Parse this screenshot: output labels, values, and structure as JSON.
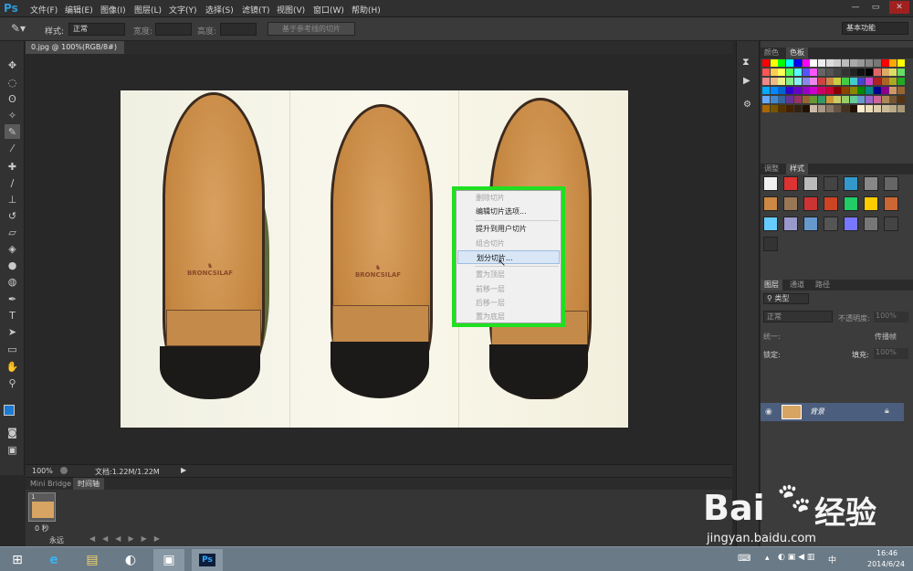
{
  "app": {
    "logo": "Ps"
  },
  "menubar": {
    "items": [
      "文件(F)",
      "编辑(E)",
      "图像(I)",
      "图层(L)",
      "文字(Y)",
      "选择(S)",
      "滤镜(T)",
      "视图(V)",
      "窗口(W)",
      "帮助(H)"
    ],
    "window_controls": [
      "—",
      "▭",
      "✕"
    ]
  },
  "options": {
    "style_label": "样式:",
    "style_value": "正常",
    "width_label": "宽度:",
    "height_label": "高度:",
    "slices_button": "基于参考线的切片",
    "workspace": "基本功能"
  },
  "document": {
    "tab_title": "0.jpg @ 100%(RGB/8#)",
    "tab_close": "×"
  },
  "canvas": {
    "brand_text": "BRONCSILAF"
  },
  "context_menu": {
    "items": [
      {
        "label": "删除切片",
        "disabled": true
      },
      {
        "label": "编辑切片选项...",
        "disabled": false
      },
      {
        "label": "提升到用户切片",
        "disabled": false
      },
      {
        "label": "组合切片",
        "disabled": true
      },
      {
        "label": "划分切片...",
        "disabled": false,
        "highlighted": true
      },
      {
        "label": "置为顶层",
        "disabled": true
      },
      {
        "label": "前移一层",
        "disabled": true
      },
      {
        "label": "后移一层",
        "disabled": true
      },
      {
        "label": "置为底层",
        "disabled": true
      }
    ]
  },
  "statusbar": {
    "zoom": "100%",
    "doc_info": "文档:1.22M/1.22M"
  },
  "bottom_panel": {
    "tabs": [
      "Mini Bridge",
      "时间轴"
    ],
    "frame_number": "1",
    "frame_delay": "0 秒",
    "loop": "永远"
  },
  "panels": {
    "color_tabs": [
      "颜色",
      "色板"
    ],
    "adjust_tabs": [
      "调整",
      "样式"
    ],
    "layers_tabs": [
      "图层",
      "通道",
      "路径"
    ],
    "layer_kind": "类型",
    "blend_mode": "正常",
    "opacity_label": "不透明度:",
    "opacity_value": "100%",
    "lock_label": "锁定:",
    "fill_label": "填充:",
    "fill_value": "100%",
    "unify_label": "统一:",
    "propagate_label": "传播帧",
    "background_layer": "背景"
  },
  "taskbar": {
    "time": "16:46",
    "date": "2014/6/24",
    "ime": "中"
  },
  "watermark": {
    "brand_left": "Bai",
    "brand_right": "经验",
    "url": "jingyan.baidu.com"
  },
  "colors": {
    "accent": "#2f9bd8",
    "highlight_border": "#20e020",
    "layer_selected": "#4c5e7d"
  }
}
